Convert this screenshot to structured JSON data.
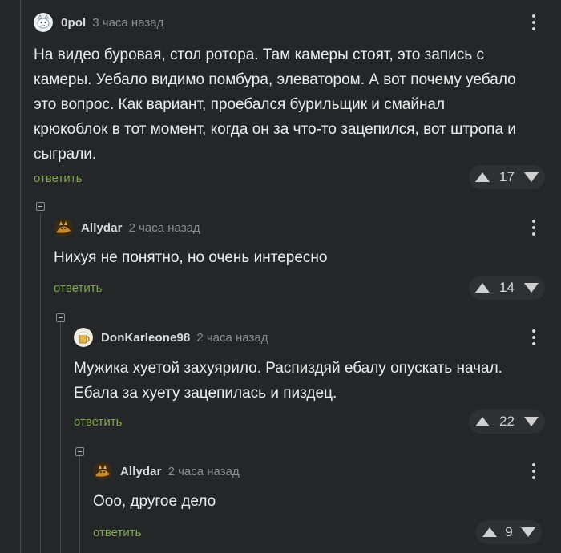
{
  "comments": [
    {
      "username": "0pol",
      "time": "3 часа назад",
      "text_lines": [
        "На видео буровая, стол ротора. Там камеры стоят, это запись с",
        "камеры. Уебало видимо помбура, элеватором. А вот почему уебало",
        "это вопрос. Как вариант, проебался бурильщик и смайнал",
        "крюкоблок в тот момент, когда он за что-то зацепился, вот штропа и",
        "сыграли."
      ],
      "reply_label": "ответить",
      "rating": "17",
      "avatar_icon": "cat-avatar-icon"
    },
    {
      "username": "Allydar",
      "time": "2 часа назад",
      "text_lines": [
        "Нихуя не понятно, но очень интересно"
      ],
      "reply_label": "ответить",
      "rating": "14",
      "avatar_icon": "fox-avatar-icon"
    },
    {
      "username": "DonKarleone98",
      "time": "2 часа назад",
      "text_lines": [
        "Мужика хуетой захуярило. Распиздяй ебалу опускать начал.",
        "Ебала за хуету зацепилась и пиздец."
      ],
      "reply_label": "ответить",
      "rating": "22",
      "avatar_icon": "beer-avatar-icon"
    },
    {
      "username": "Allydar",
      "time": "2 часа назад",
      "text_lines": [
        "Ооо, другое дело"
      ],
      "reply_label": "ответить",
      "rating": "9",
      "avatar_icon": "fox-avatar-icon"
    }
  ],
  "colors": {
    "background": "#252627",
    "reply_link": "#7fa751",
    "vote_bg": "#2f3031"
  }
}
